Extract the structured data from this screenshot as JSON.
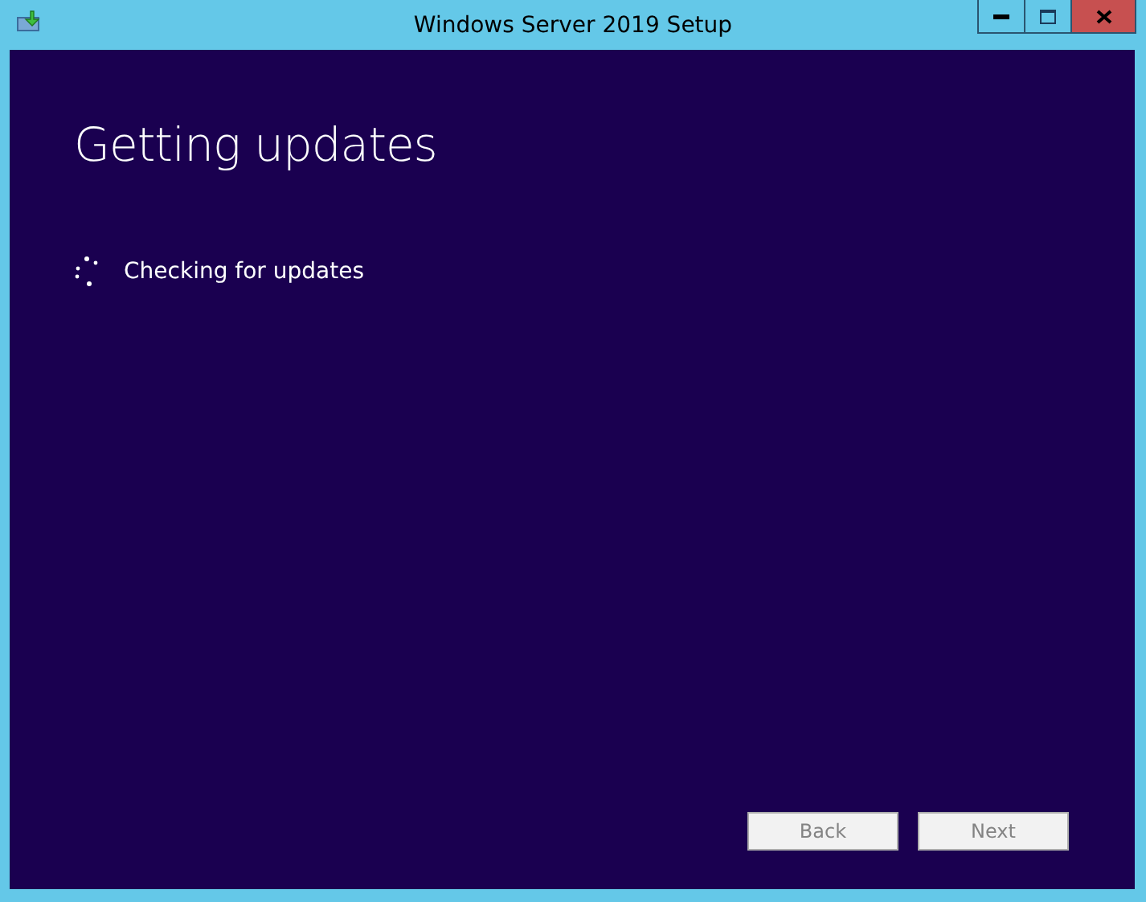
{
  "window": {
    "title": "Windows Server 2019 Setup"
  },
  "heading": "Getting updates",
  "status": {
    "text": "Checking for updates",
    "busy": true
  },
  "buttons": [
    {
      "label": "Back",
      "disabled": true
    },
    {
      "label": "Next",
      "disabled": true
    }
  ]
}
